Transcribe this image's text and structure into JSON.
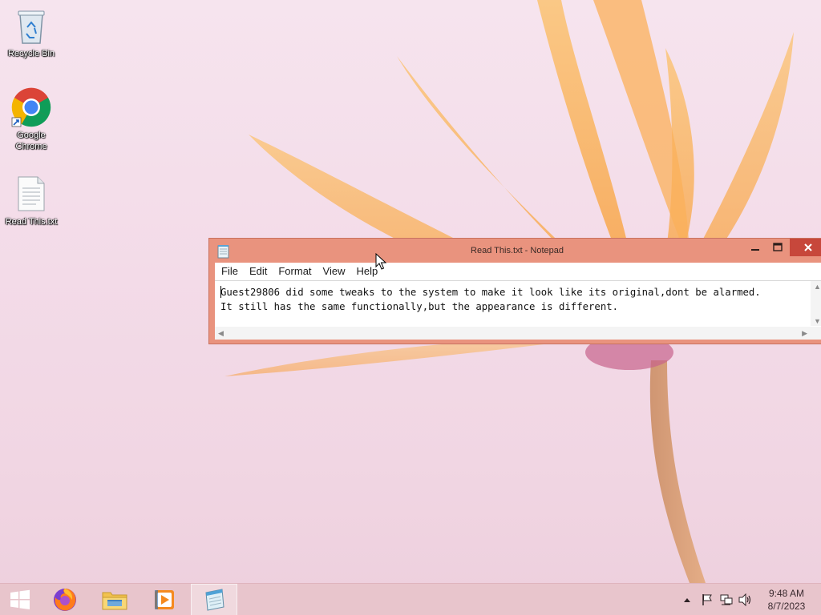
{
  "desktop": {
    "icons": [
      {
        "label": "Recycle Bin",
        "icon": "recycle-bin-icon"
      },
      {
        "label": "Google Chrome",
        "icon": "chrome-icon"
      },
      {
        "label": "Read This.txt",
        "icon": "text-file-icon"
      }
    ]
  },
  "notepad": {
    "title": "Read This.txt - Notepad",
    "menu": [
      "File",
      "Edit",
      "Format",
      "View",
      "Help"
    ],
    "content_line1": "Guest29806 did some tweaks to the system to make it look like its original,dont be alarmed.",
    "content_line2": "It still has the same functionally,but the appearance is different.",
    "window_buttons": [
      "minimize-icon",
      "maximize-icon",
      "close-icon"
    ]
  },
  "taskbar": {
    "items": [
      "windows-start-icon",
      "firefox-icon",
      "file-explorer-icon",
      "media-player-icon",
      "notepad-icon"
    ],
    "tray_icons": [
      "show-hidden-icons-arrow",
      "action-center-flag-icon",
      "network-icon",
      "volume-icon"
    ],
    "time": "9:48 AM",
    "date": "8/7/2023"
  },
  "colors": {
    "window_frame": "#e9937e",
    "close_button": "#c7473b",
    "taskbar": "#e8c5cc"
  }
}
